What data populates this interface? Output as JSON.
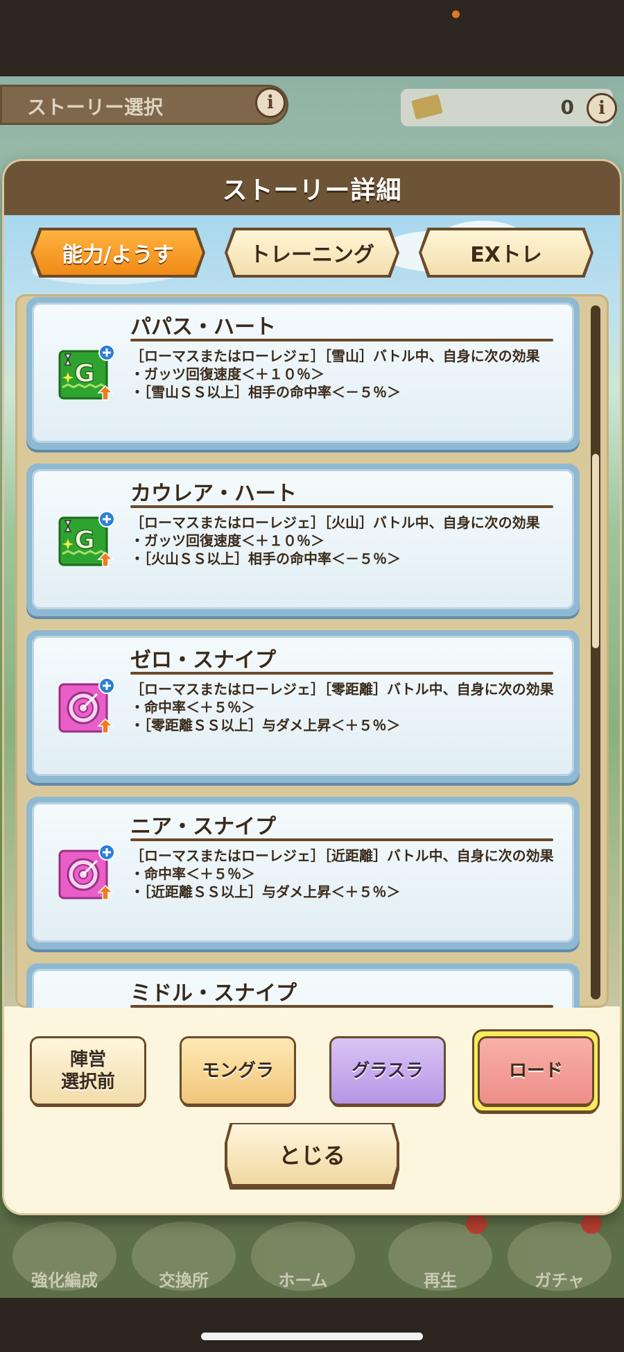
{
  "background": {
    "story_select_label": "ストーリー選択",
    "ticket_count": "0",
    "nav_items": [
      "強化編成",
      "交換所",
      "ホーム",
      "再生",
      "ガチャ"
    ]
  },
  "modal": {
    "title": "ストーリー詳細",
    "tabs": [
      {
        "label": "能力/ようす",
        "active": true
      },
      {
        "label": "トレーニング",
        "active": false
      },
      {
        "label": "EXトレ",
        "active": false
      }
    ],
    "skills": [
      {
        "name": "パパス・ハート",
        "icon": "guts-up-icon",
        "description": "［ローマスまたはローレジェ］［雪山］バトル中、自身に次の効果\n・ガッツ回復速度＜＋１０％＞\n・［雪山ＳＳ以上］相手の命中率＜－５％＞"
      },
      {
        "name": "カウレア・ハート",
        "icon": "guts-up-icon",
        "description": "［ローマスまたはローレジェ］［火山］バトル中、自身に次の効果\n・ガッツ回復速度＜＋１０％＞\n・［火山ＳＳ以上］相手の命中率＜－５％＞"
      },
      {
        "name": "ゼロ・スナイプ",
        "icon": "accuracy-up-icon",
        "description": "［ローマスまたはローレジェ］［零距離］バトル中、自身に次の効果\n・命中率＜＋５％＞\n・［零距離ＳＳ以上］与ダメ上昇＜＋５％＞"
      },
      {
        "name": "ニア・スナイプ",
        "icon": "accuracy-up-icon",
        "description": "［ローマスまたはローレジェ］［近距離］バトル中、自身に次の効果\n・命中率＜＋５％＞\n・［近距離ＳＳ以上］与ダメ上昇＜＋５％＞"
      },
      {
        "name": "ミドル・スナイプ",
        "icon": "accuracy-up-icon",
        "description": ""
      }
    ],
    "mode_buttons": [
      {
        "label": "陣営\n選択前",
        "style": "cream"
      },
      {
        "label": "モングラ",
        "style": "gold"
      },
      {
        "label": "グラスラ",
        "style": "purple"
      },
      {
        "label": "ロード",
        "style": "pink",
        "selected": true
      }
    ],
    "close_label": "とじる"
  }
}
